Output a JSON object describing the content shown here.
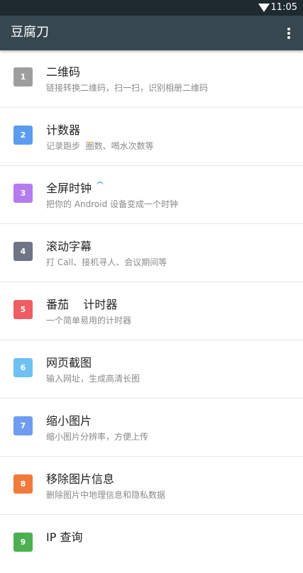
{
  "status_bar": {
    "time": "11:05"
  },
  "app_bar": {
    "title": "豆腐刀"
  },
  "items": [
    {
      "num": "1",
      "title": "二维码",
      "desc": "链接转换二维码，扫一扫，识别相册二维码",
      "color": "#9e9e9e"
    },
    {
      "num": "2",
      "title": "计数器",
      "desc": "记录跑步  圈数、喝水次数等",
      "color": "#5b9bf0"
    },
    {
      "num": "3",
      "title": "全屏时钟",
      "desc": "把你的 Android 设备变成一个时钟",
      "color": "#b57cf0"
    },
    {
      "num": "4",
      "title": "滚动字幕",
      "desc": "打 Call、接机寻人、会议期间等",
      "color": "#6f7586"
    },
    {
      "num": "5",
      "title": "番茄    计时器",
      "desc": "一个简单易用的计时器",
      "color": "#ef5c63"
    },
    {
      "num": "6",
      "title": "网页截图",
      "desc": "输入网址，生成高清长图",
      "color": "#6ec1f2"
    },
    {
      "num": "7",
      "title": "缩小图片",
      "desc": "缩小图片分辨率，方便上传",
      "color": "#6f9cf0"
    },
    {
      "num": "8",
      "title": "移除图片信息",
      "desc": "删除图片中地理信息和隐私数据",
      "color": "#f07a3a"
    },
    {
      "num": "9",
      "title": "IP 查询",
      "desc": "",
      "color": "#4caf50"
    }
  ]
}
